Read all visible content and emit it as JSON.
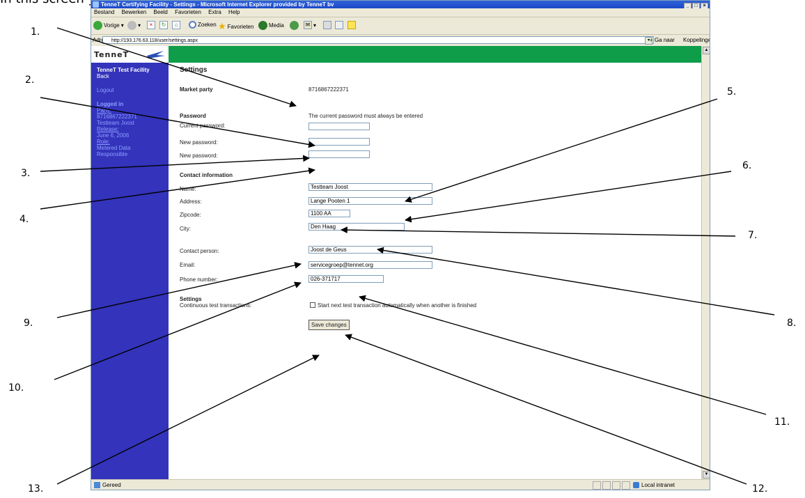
{
  "doc_heading": "In this screen you can change your personal settings.",
  "browser": {
    "title": "TenneT Certifying Facility - Settings - Microsoft Internet Explorer provided by TenneT bv",
    "menu": [
      "Bestand",
      "Bewerken",
      "Beeld",
      "Favorieten",
      "Extra",
      "Help"
    ],
    "toolbar": {
      "back": "Vorige",
      "search": "Zoeken",
      "favorites": "Favorieten",
      "media": "Media"
    },
    "address_label": "Adres",
    "address_url": "http://193.176.63.118/user/settings.aspx",
    "go_label": "Ga naar",
    "links_label": "Koppelingen",
    "status_text": "Gereed",
    "zone_text": "Local intranet"
  },
  "site": {
    "logo": "TenneT",
    "sidebar": {
      "title": "TenneT Test Facility",
      "back": "Back",
      "logout": "Logout",
      "logged_in": "Logged in",
      "party_label": "Party:",
      "party_value": "8716867222371",
      "user": "Testteam Joost",
      "release_label": "Release:",
      "release_value": "June 6, 2006",
      "role_label": "Role:",
      "role_value1": "Metered Data",
      "role_value2": "Responsible"
    }
  },
  "form": {
    "heading": "Settings",
    "market_party_label": "Market party",
    "market_party_value": "8716867222371",
    "password_heading": "Password",
    "password_note": "The current password must always be entered",
    "current_password_label": "Current password:",
    "new_password_label": "New password:",
    "new_password2_label": "New password:",
    "contact_heading": "Contact information",
    "name_label": "Name:",
    "name_value": "Testteam Joost",
    "address_label": "Address:",
    "address_value": "Lange Pooten 1",
    "zipcode_label": "Zipcode:",
    "zipcode_value": "1100 AA",
    "city_label": "City:",
    "city_value": "Den Haag",
    "contact_person_label": "Contact person:",
    "contact_person_value": "Joost de Geus",
    "email_label": "Email:",
    "email_value": "servicegroep@tennet.org",
    "phone_label": "Phone number:",
    "phone_value": "026-371717",
    "settings_heading": "Settings",
    "continuous_label": "Continuous test transactions:",
    "continuous_checkbox_label": "Start next test transaction automatically when another is finished",
    "continuous_checked": false,
    "save_label": "Save changes"
  },
  "callouts": [
    "1.",
    "2.",
    "3.",
    "4.",
    "5.",
    "6.",
    "7.",
    "8.",
    "9.",
    "10.",
    "11.",
    "12.",
    "13."
  ]
}
